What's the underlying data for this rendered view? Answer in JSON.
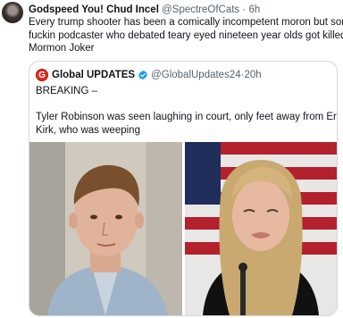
{
  "tweet": {
    "author_name": "Godspeed You! Chud Incel",
    "handle": "@SpectreOfCats",
    "separator": "·",
    "time": "6h",
    "text_lines": [
      "Every trump shooter has been a comically incompetent moron but some",
      "fuckin podcaster who debated teary eyed nineteen year olds got killed by",
      "Mormon Joker"
    ]
  },
  "quote": {
    "logo_letter": "G",
    "author_name": "Global UPDATES",
    "handle": "@GlobalUpdates24",
    "separator": "·",
    "time": "20h",
    "headline": "BREAKING –",
    "body_lines": [
      "Tyler Robinson was seen laughing in court, only feet away from Erika",
      "Kirk, who was weeping"
    ]
  },
  "icons": {
    "avatar": "profile-avatar",
    "logo": "global-updates-logo",
    "verified": "verified-badge-icon"
  },
  "colors": {
    "secondary_text": "#536471",
    "border": "#cfd9de",
    "verified_blue": "#1d9bf0",
    "logo_red": "#e32a1f"
  }
}
